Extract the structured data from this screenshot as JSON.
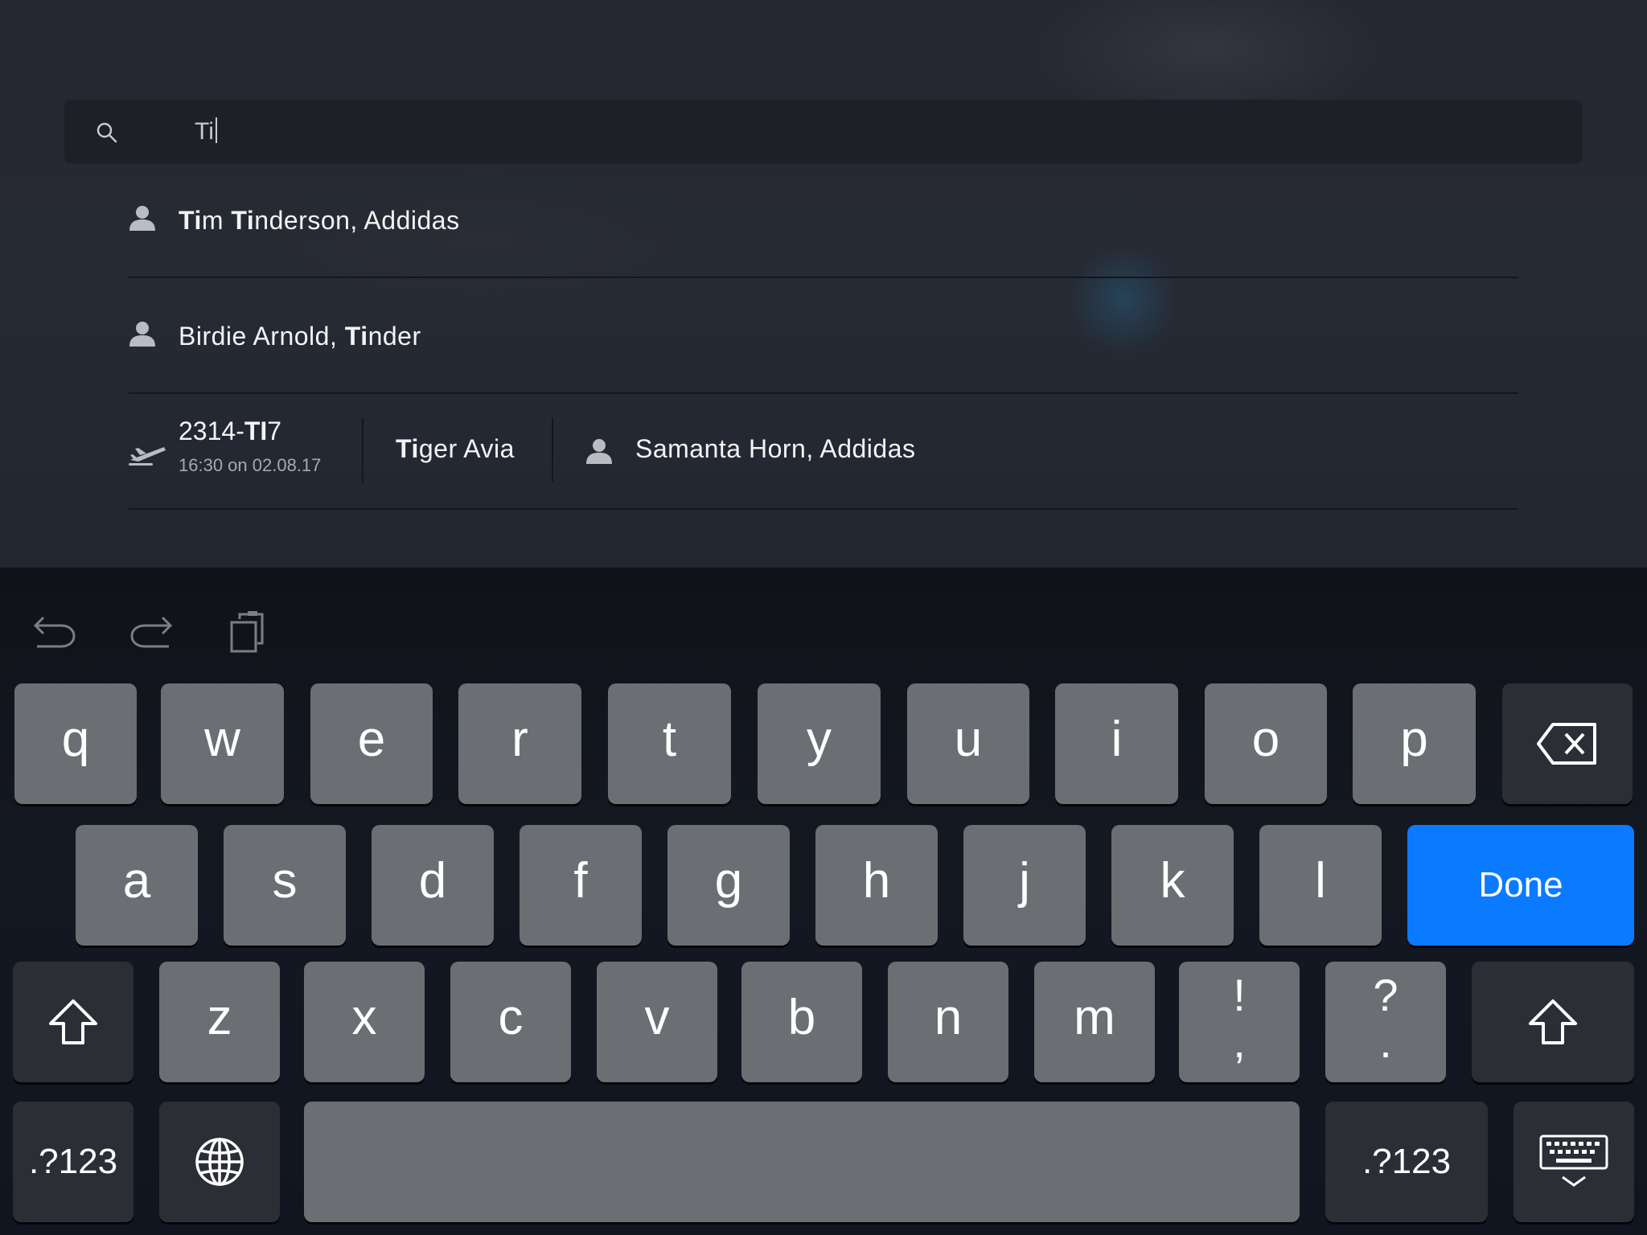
{
  "search": {
    "query": "Ti"
  },
  "results": [
    {
      "bold": "Ti",
      "rest_a": "m ",
      "bold2": "Ti",
      "rest_b": "nderson, Addidas"
    },
    {
      "plain": "Birdie Arnold, ",
      "bold": "Ti",
      "rest": "nder"
    }
  ],
  "flight": {
    "num_plain": "2314-",
    "num_bold": "TI",
    "num_rest": "7",
    "time": "16:30 on 02.08.17",
    "airline_bold": "Ti",
    "airline_rest": "ger Avia",
    "contact": "Samanta Horn, Addidas"
  },
  "keyboard": {
    "row1": [
      "q",
      "w",
      "e",
      "r",
      "t",
      "y",
      "u",
      "i",
      "o",
      "p"
    ],
    "row2": [
      "a",
      "s",
      "d",
      "f",
      "g",
      "h",
      "j",
      "k",
      "l"
    ],
    "row3": [
      "z",
      "x",
      "c",
      "v",
      "b",
      "n",
      "m"
    ],
    "punct1_top": "!",
    "punct1_bottom": ",",
    "punct2_top": "?",
    "punct2_bottom": ".",
    "done_label": "Done",
    "numbers_label": ".?123"
  },
  "colors": {
    "accent": "#0a7bff",
    "key": "#6b6e73",
    "key_dark": "#2b2e35"
  },
  "icons": [
    "search-icon",
    "person-icon",
    "plane-icon",
    "undo-icon",
    "redo-icon",
    "paste-icon",
    "delete-icon",
    "shift-icon",
    "globe-icon",
    "keyboard-dismiss-icon"
  ]
}
